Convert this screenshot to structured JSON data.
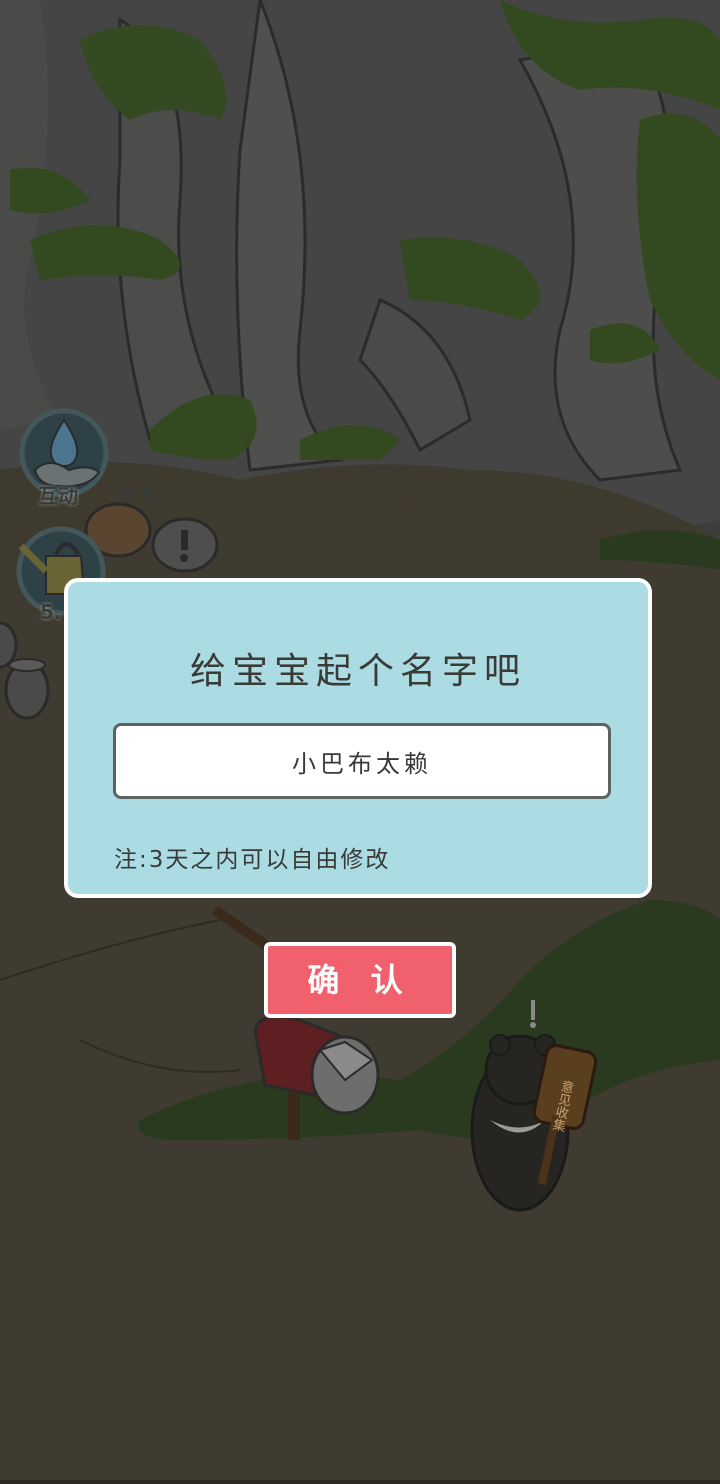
{
  "side_buttons": [
    {
      "label": "互动",
      "icon": "water-drop-hand-icon"
    },
    {
      "label": "5.",
      "icon": "watering-can-icon"
    }
  ],
  "dialog": {
    "title": "给宝宝起个名字吧",
    "name_value": "小巴布太赖",
    "note": "注:3天之内可以自由修改"
  },
  "confirm_label": "确 认",
  "sign_text": "意见收集",
  "colors": {
    "dialog_bg": "#abdce4",
    "confirm_bg": "#f0606d",
    "text": "#3a3a36"
  }
}
